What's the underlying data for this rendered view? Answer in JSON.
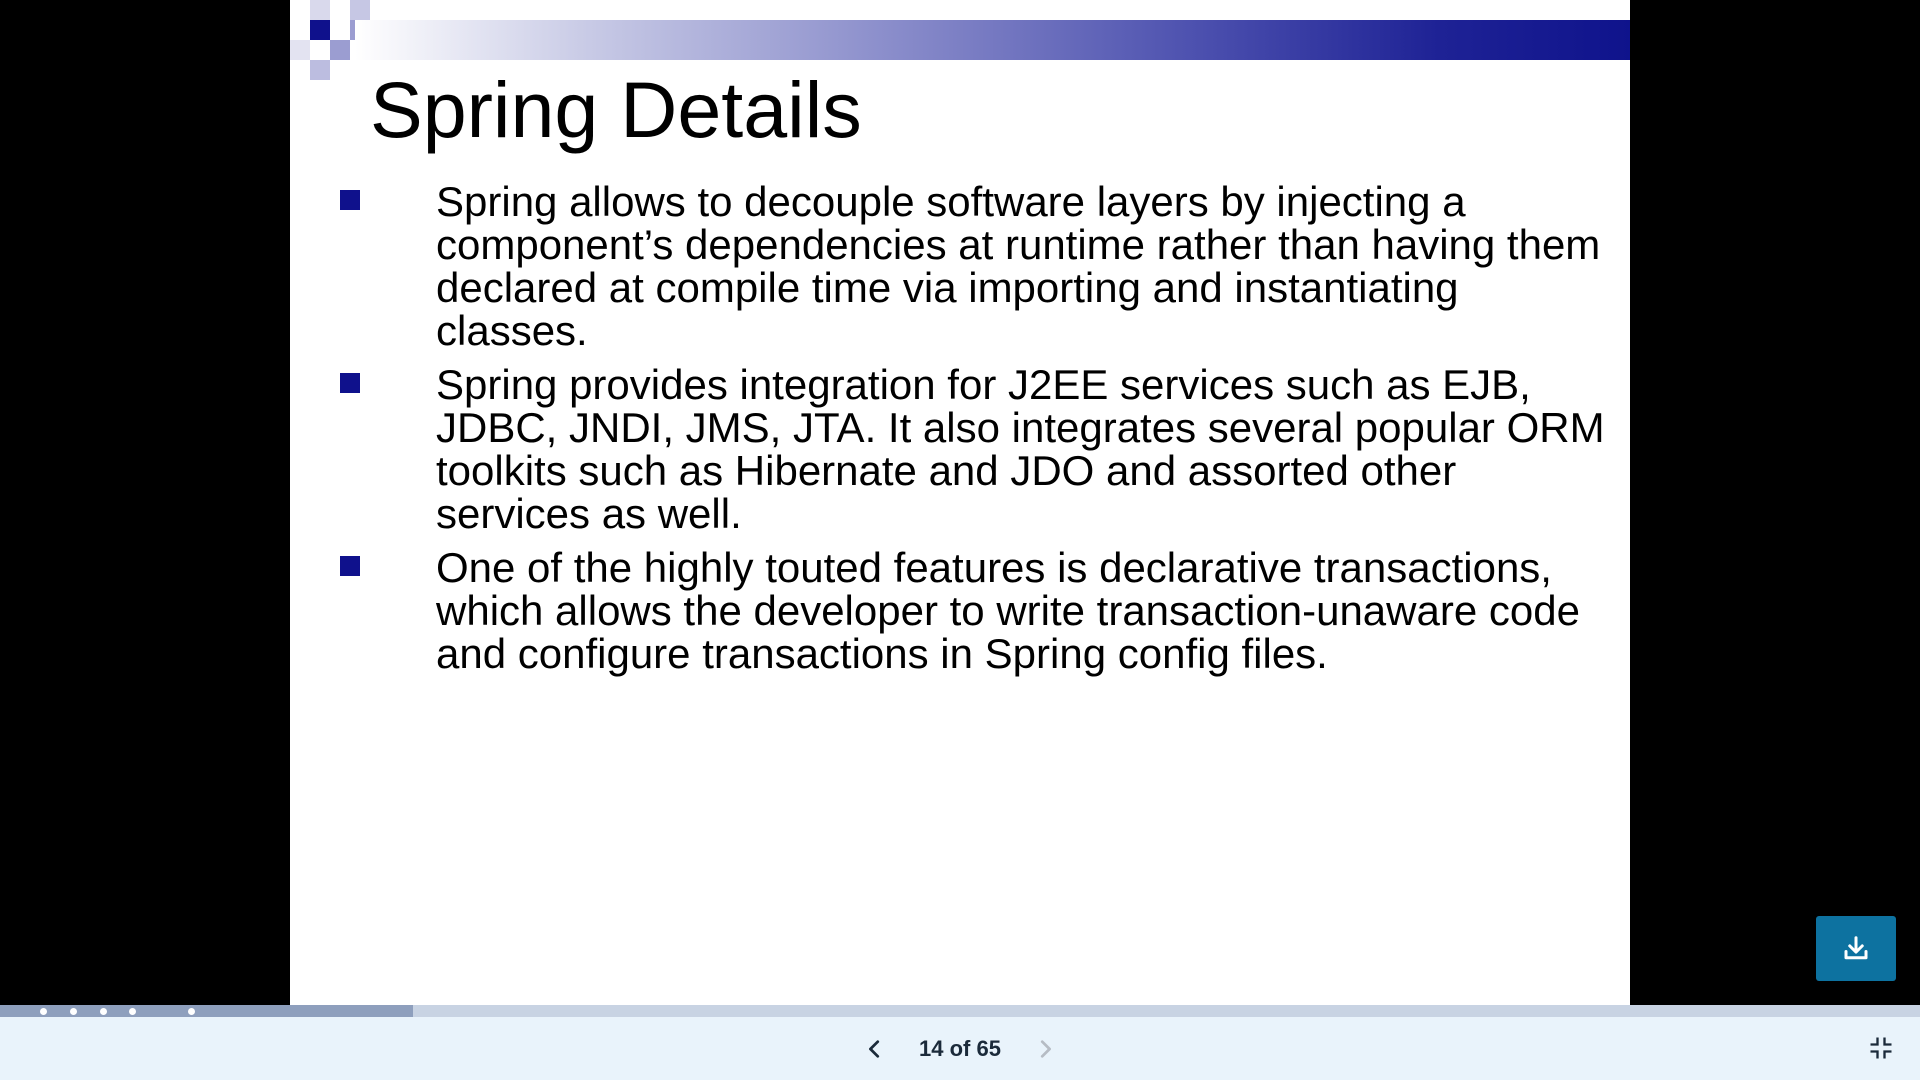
{
  "slide": {
    "title": "Spring Details",
    "bullets": [
      "Spring allows to decouple software layers by injecting a component’s dependencies at runtime rather than having them declared at compile time via importing and instantiating classes.",
      "Spring provides integration for J2EE services such as EJB, JDBC, JNDI, JMS, JTA. It also integrates several popular ORM toolkits such as Hibernate and JDO and assorted other services as well.",
      "One of the highly touted features is declarative transactions, which allows the developer to write transaction-unaware code and configure transactions in Spring config files."
    ],
    "colors": {
      "accent": "#0f118c",
      "title_bar_end": "#0f138c"
    }
  },
  "controls": {
    "page_indicator": "14 of 65",
    "current_page": 14,
    "total_pages": 65,
    "progress_fraction": 0.215,
    "download_icon": "download-icon",
    "prev_icon": "chevron-left-icon",
    "next_icon": "chevron-right-icon",
    "exit_fullscreen_icon": "exit-fullscreen-icon",
    "colors": {
      "download_bg": "#0d72a0",
      "bottom_bar_bg": "#e9f3fb",
      "progress_track": "#c8d3e3",
      "progress_fill": "#8e9fbd"
    }
  }
}
